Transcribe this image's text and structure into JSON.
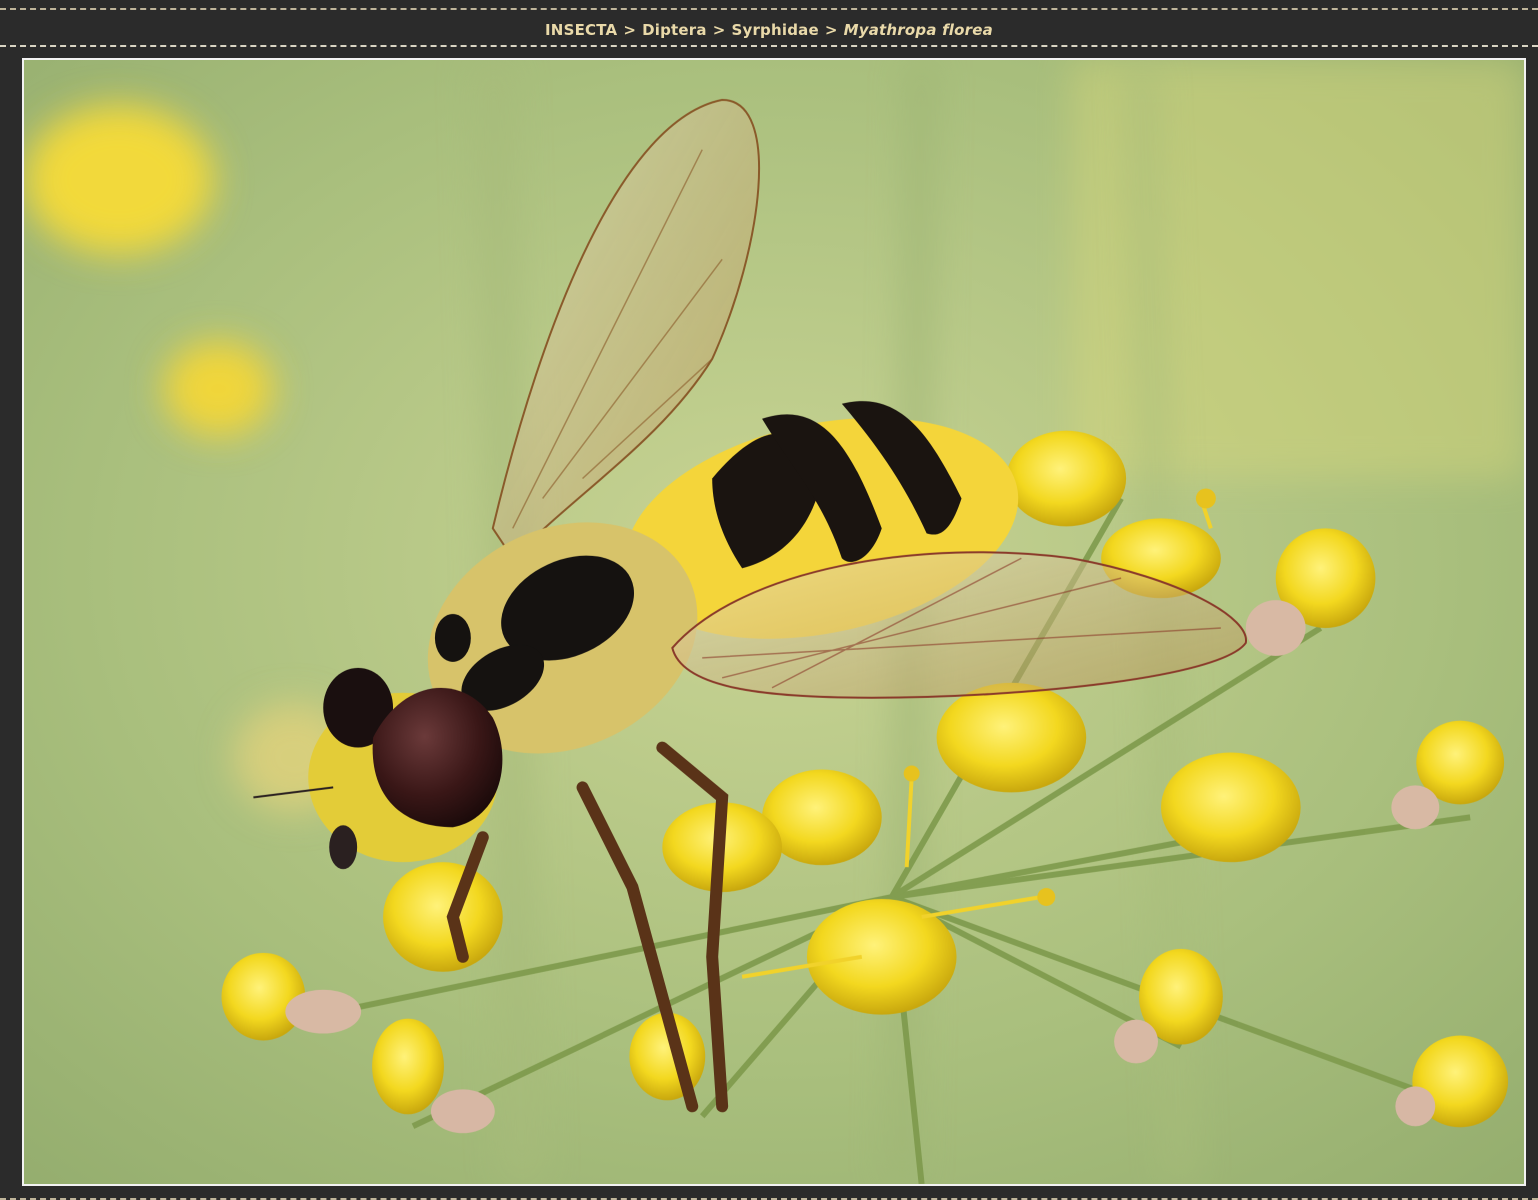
{
  "breadcrumb": {
    "order": "INSECTA",
    "family_order": "Diptera",
    "family": "Syrphidae",
    "species": "Myathropa florea",
    "separator": ">"
  },
  "colors": {
    "page_background": "#2b2b2b",
    "breadcrumb_text": "#e9d9a9",
    "photo_border": "#f2f2f2"
  },
  "photo": {
    "subject": "hoverfly-on-fennel-flowers"
  }
}
